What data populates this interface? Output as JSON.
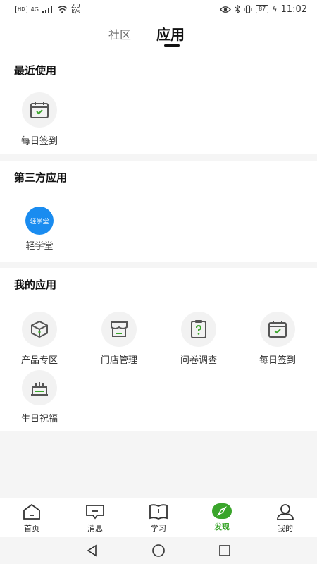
{
  "status_bar": {
    "network_badge": "HD",
    "signal_label": "4G",
    "net_speed_value": "2.9",
    "net_speed_unit": "K/s",
    "battery": "87",
    "time": "11:02"
  },
  "top_tabs": {
    "community": "社区",
    "apps": "应用",
    "active": "apps"
  },
  "sections": {
    "recent": {
      "title": "最近使用",
      "items": [
        {
          "label": "每日签到",
          "icon": "calendar-check-icon"
        }
      ]
    },
    "third_party": {
      "title": "第三方应用",
      "items": [
        {
          "label": "轻学堂",
          "badge_text": "轻学堂",
          "icon": "qingxuetang-logo"
        }
      ]
    },
    "mine": {
      "title": "我的应用",
      "items": [
        {
          "label": "产品专区",
          "icon": "box-icon"
        },
        {
          "label": "门店管理",
          "icon": "store-icon"
        },
        {
          "label": "问卷调查",
          "icon": "questionnaire-icon"
        },
        {
          "label": "每日签到",
          "icon": "calendar-check-icon"
        },
        {
          "label": "生日祝福",
          "icon": "birthday-cake-icon"
        }
      ]
    }
  },
  "bottom_nav": {
    "items": [
      {
        "label": "首页",
        "icon": "home-icon"
      },
      {
        "label": "消息",
        "icon": "message-icon"
      },
      {
        "label": "学习",
        "icon": "book-icon"
      },
      {
        "label": "发现",
        "icon": "compass-icon"
      },
      {
        "label": "我的",
        "icon": "user-icon"
      }
    ],
    "active": "发现"
  },
  "colors": {
    "accent_green": "#3aa52b",
    "brand_blue": "#1a8cf0",
    "icon_gray": "#555555"
  }
}
